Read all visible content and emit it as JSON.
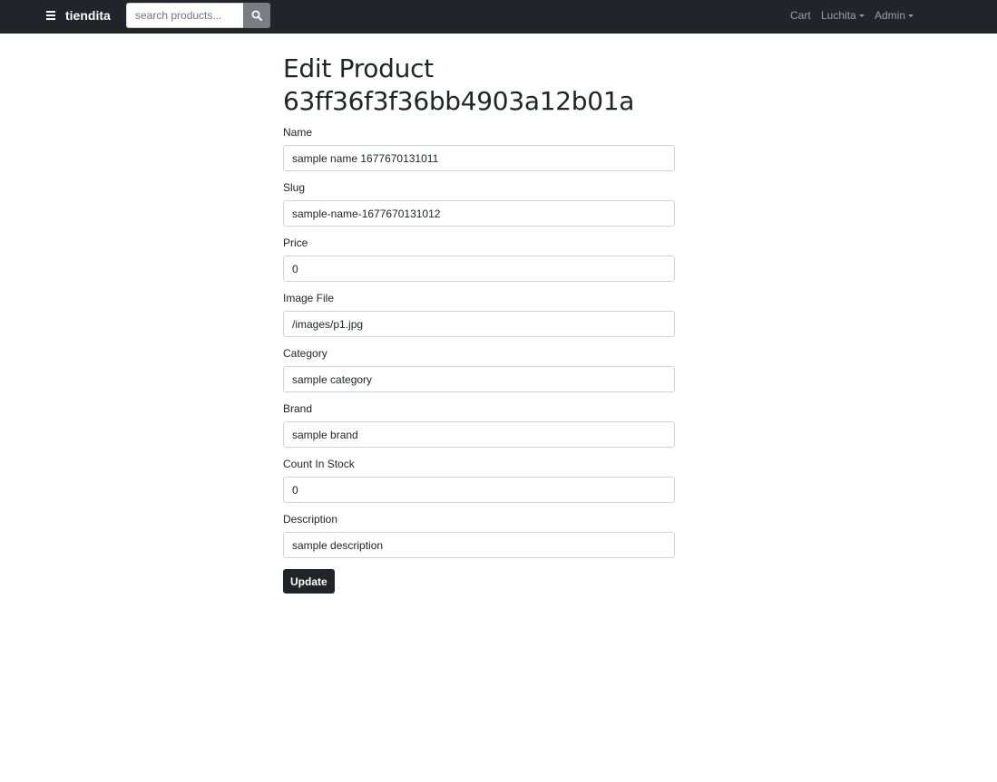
{
  "navbar": {
    "brand": "tiendita",
    "search_placeholder": "search products...",
    "cart_label": "Cart",
    "user_label": "Luchita",
    "admin_label": "Admin"
  },
  "page": {
    "title_line1": "Edit Product",
    "title_line2": "63ff36f3f36bb4903a12b01a"
  },
  "form": {
    "fields": [
      {
        "label": "Name",
        "value": "sample name 1677670131011"
      },
      {
        "label": "Slug",
        "value": "sample-name-1677670131012"
      },
      {
        "label": "Price",
        "value": "0"
      },
      {
        "label": "Image File",
        "value": "/images/p1.jpg"
      },
      {
        "label": "Category",
        "value": "sample category"
      },
      {
        "label": "Brand",
        "value": "sample brand"
      },
      {
        "label": "Count In Stock",
        "value": "0"
      },
      {
        "label": "Description",
        "value": "sample description"
      }
    ],
    "submit_label": "Update"
  },
  "colors": {
    "navbar_bg": "#212529",
    "button_bg": "#212529",
    "search_button_bg": "#7a7e82"
  },
  "icons": {
    "menu": "hamburger-menu-icon",
    "search": "search-icon",
    "dropdown": "chevron-down-icon"
  }
}
